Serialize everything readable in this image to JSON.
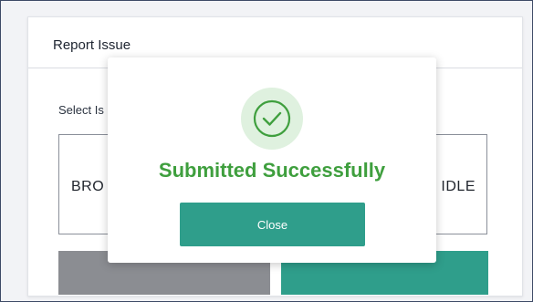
{
  "panel": {
    "title": "Report Issue",
    "select_label": "Select Is",
    "option_left": "BRO",
    "option_right": "IDLE"
  },
  "modal": {
    "message": "Submitted Successfully",
    "close_label": "Close",
    "icon": "check-circle"
  },
  "colors": {
    "accent_teal": "#2f9e8b",
    "success_green": "#3f9f3e",
    "secondary_gray": "#8b8d92"
  }
}
